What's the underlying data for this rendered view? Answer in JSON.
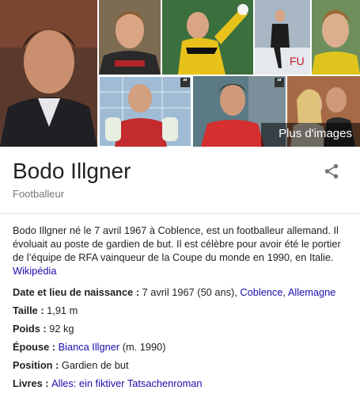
{
  "more_images_label": "Plus d'images",
  "colors": {
    "link": "#1a0dab",
    "subtitle": "#777777",
    "text": "#222222"
  },
  "header": {
    "title": "Bodo Illgner",
    "subtitle": "Footballeur",
    "share_icon": "share-icon"
  },
  "description": {
    "text": "Bodo Illgner né le 7 avril 1967 à Coblence, est un footballeur allemand. Il évoluait au poste de gardien de but. Il est célèbre pour avoir été le portier de l’équipe de RFA vainqueur de la Coupe du monde en 1990, en Italie.",
    "source_link": "Wikipédia"
  },
  "facts": {
    "birth": {
      "label": "Date et lieu de naissance : ",
      "value": "7 avril 1967 (50 ans), ",
      "link1": "Coblence",
      "sep": ", ",
      "link2": "Allemagne"
    },
    "height": {
      "label": "Taille : ",
      "value": "1,91 m"
    },
    "weight": {
      "label": "Poids : ",
      "value": "92 kg"
    },
    "spouse": {
      "label": "Épouse : ",
      "link": "Bianca Illgner",
      "suffix": " (m. 1990)"
    },
    "position": {
      "label": "Position : ",
      "value": "Gardien de but"
    },
    "books": {
      "label": "Livres : ",
      "link": "Alles: ein fiktiver Tatsachenroman"
    }
  }
}
